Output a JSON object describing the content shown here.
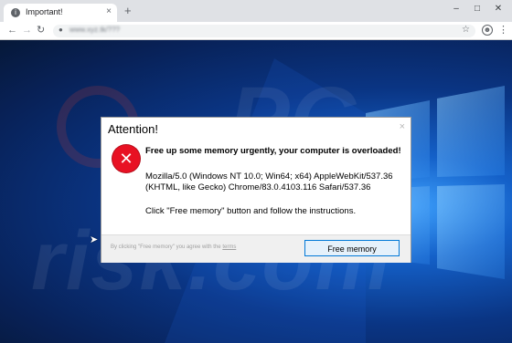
{
  "browser": {
    "tab_title": "Important!",
    "tab_close": "×",
    "new_tab": "+",
    "window_controls": {
      "minimize": "–",
      "maximize": "□",
      "close": "✕"
    },
    "nav": {
      "back": "←",
      "forward": "→",
      "reload": "↻"
    },
    "address": "www.xyz.tk/???",
    "icons": [
      "info-icon",
      "lock-icon",
      "star-icon",
      "profile-icon",
      "menu-icon"
    ]
  },
  "dialog": {
    "title": "Attention!",
    "close": "×",
    "heading": "Free up some memory urgently, your computer is overloaded!",
    "user_agent_line1": "Mozilla/5.0 (Windows NT 10.0; Win64; x64) AppleWebKit/537.36",
    "user_agent_line2": "(KHTML, like Gecko) Chrome/83.0.4103.116 Safari/537.36",
    "instruction": "Click \"Free memory\" button and follow the instructions.",
    "fine_print_prefix": "By clicking \"Free memory\" you agree with the ",
    "fine_print_link": "terms",
    "button_label": "Free memory",
    "error_glyph": "✕"
  },
  "watermark": {
    "line1": "PC",
    "line2": "risk.com"
  },
  "colors": {
    "error_red": "#e81123",
    "button_border": "#0078d7",
    "wallpaper": "#0a3584"
  }
}
